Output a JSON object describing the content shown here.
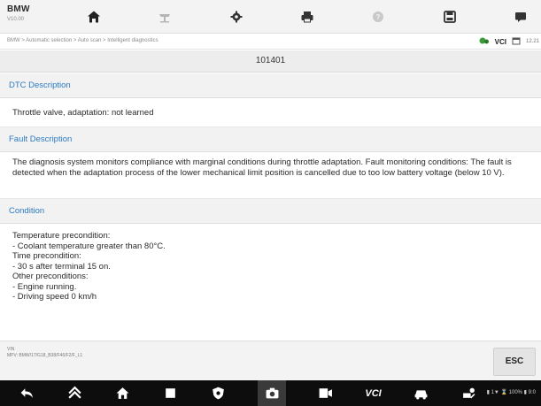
{
  "header": {
    "brand": "BMW",
    "version": "V10.00",
    "toolbar_icons": [
      "home-icon",
      "vehicle-lift-icon",
      "gear-icon",
      "print-icon",
      "help-icon",
      "save-icon",
      "message-icon"
    ]
  },
  "breadcrumb": "BMW > Automatic selection > Auto scan > Intelligent diagnostics",
  "status": {
    "vci_label": "VCI",
    "date": "12.21"
  },
  "title": "101401",
  "sections": {
    "dtc_header": "DTC Description",
    "dtc_text": "Throttle valve, adaptation: not learned",
    "fault_header": "Fault Description",
    "fault_text": "The diagnosis system monitors compliance with marginal conditions during throttle adaptation. Fault monitoring conditions: The fault is detected when the adaptation process of the lower mechanical limit position is cancelled due to too low battery voltage (below 10 V).",
    "condition_header": "Condition",
    "condition_lines": [
      "Temperature precondition:",
      "- Coolant temperature greater than 80°C.",
      "Time precondition:",
      "- 30 s after terminal 15 on.",
      "Other preconditions:",
      "- Engine running.",
      "- Driving speed 0 km/h"
    ]
  },
  "footer": {
    "vin_label": "VIN",
    "vin_value": "MPV: BMW/17/G18_B38/F46/F2/F_L1",
    "esc_label": "ESC"
  },
  "navbar": {
    "vci_text": "VCI",
    "system_status": "▮ 1▼ ⌛ 100% ▮ 9:0"
  },
  "colors": {
    "section_header_text": "#2b7bc1",
    "nav_background": "#0d0d0d"
  }
}
